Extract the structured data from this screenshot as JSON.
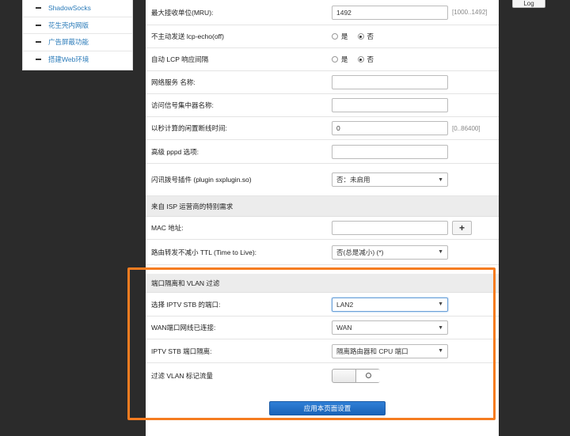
{
  "sidebar": {
    "items": [
      {
        "label": "ShadowSocks"
      },
      {
        "label": "花生壳内网版"
      },
      {
        "label": "广告屏蔽功能"
      },
      {
        "label": "搭建Web环境"
      }
    ]
  },
  "topbar": {
    "log_label": "Log"
  },
  "form": {
    "mru": {
      "label": "最大接收单位(MRU):",
      "value": "1492",
      "hint": "[1000..1492]"
    },
    "lcp_echo": {
      "label": "不主动发送 lcp-echo(off)",
      "yes": "是",
      "no": "否",
      "selected": "否"
    },
    "lcp_interval": {
      "label": "自动 LCP 响应间隔",
      "yes": "是",
      "no": "否",
      "selected": "否"
    },
    "service_name": {
      "label": "网络服务 名称:",
      "value": ""
    },
    "ac_name": {
      "label": "访问信号集中器名称:",
      "value": ""
    },
    "idle_timeout": {
      "label": "以秒计算的闲置断线时间:",
      "value": "0",
      "hint": "[0..86400]"
    },
    "pppd_options": {
      "label": "高级 pppd 选项:",
      "value": ""
    },
    "sxplugin": {
      "label": "闪讯拨号插件 (plugin sxplugin.so)",
      "value": "否：未启用"
    },
    "isp_section": {
      "title": "来自 ISP 运营商的特别需求"
    },
    "mac": {
      "label": "MAC 地址:",
      "value": "",
      "plus": "+"
    },
    "ttl": {
      "label": "路由转发不减小 TTL (Time to Live):",
      "value": "否(总是减小) (*)"
    },
    "vlan_section": {
      "title": "端口隔离和 VLAN 过滤"
    },
    "iptv_port": {
      "label": "选择 IPTV STB 的端口:",
      "value": "LAN2"
    },
    "wan_link": {
      "label": "WAN端口网线已连接:",
      "value": "WAN"
    },
    "iptv_isolation": {
      "label": "IPTV STB 端口隔离:",
      "value": "隔离路由器和 CPU 端口"
    },
    "vlan_filter": {
      "label": "过滤 VLAN 标记流量"
    },
    "apply": {
      "label": "应用本页面设置"
    }
  },
  "colors": {
    "highlight": "#f57c20",
    "link": "#2b7bb9",
    "primary": "#1a63b8"
  }
}
